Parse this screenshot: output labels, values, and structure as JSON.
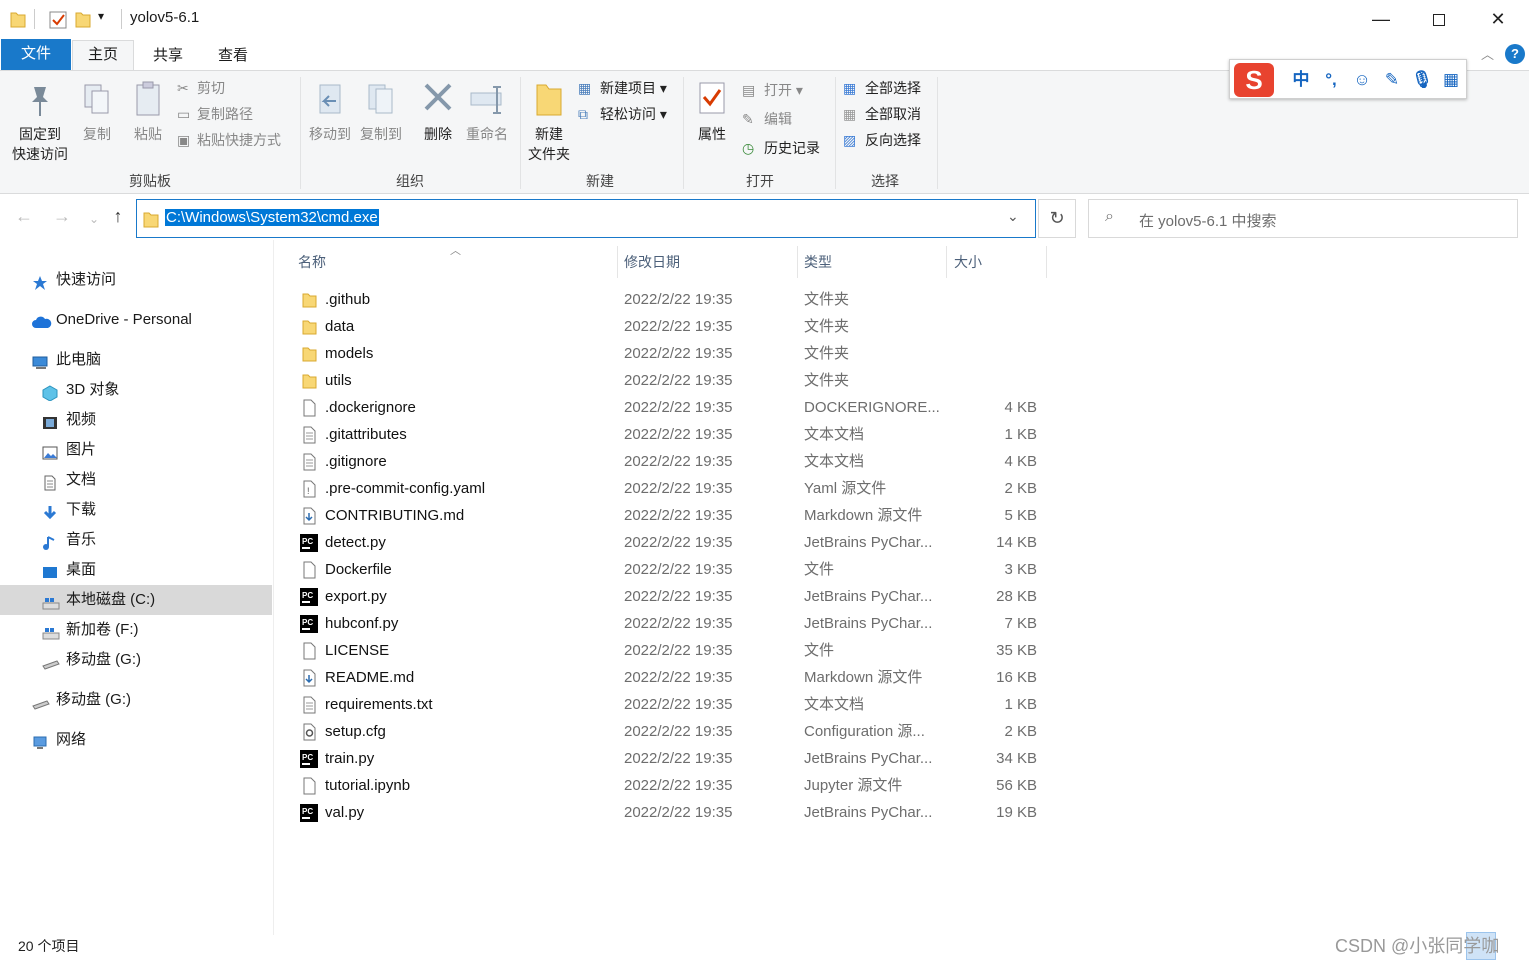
{
  "window": {
    "title": "yolov5-6.1",
    "qat_dropdown": "▾"
  },
  "ribbon_tabs": [
    "文件",
    "主页",
    "共享",
    "查看"
  ],
  "ribbon": {
    "clipboard": {
      "label": "剪贴板",
      "pin": "固定到\n快速访问",
      "copy": "复制",
      "paste": "粘贴",
      "cut": "剪切",
      "copy_path": "复制路径",
      "paste_shortcut": "粘贴快捷方式"
    },
    "organize": {
      "label": "组织",
      "move_to": "移动到",
      "copy_to": "复制到",
      "delete": "删除",
      "rename": "重命名"
    },
    "new": {
      "label": "新建",
      "new_folder": "新建\n文件夹",
      "new_item": "新建项目",
      "easy_access": "轻松访问"
    },
    "open": {
      "label": "打开",
      "properties": "属性",
      "open": "打开",
      "edit": "编辑",
      "history": "历史记录"
    },
    "select": {
      "label": "选择",
      "select_all": "全部选择",
      "select_none": "全部取消",
      "invert": "反向选择"
    }
  },
  "address": {
    "value": "C:\\Windows\\System32\\cmd.exe"
  },
  "search": {
    "placeholder": "在 yolov5-6.1 中搜索"
  },
  "sidebar": [
    {
      "label": "快速访问",
      "icon": "star-icon",
      "level": 0
    },
    {
      "label": "OneDrive - Personal",
      "icon": "cloud-icon",
      "level": 0
    },
    {
      "label": "此电脑",
      "icon": "computer-icon",
      "level": 0
    },
    {
      "label": "3D 对象",
      "icon": "cube-icon",
      "level": 1
    },
    {
      "label": "视频",
      "icon": "video-icon",
      "level": 1
    },
    {
      "label": "图片",
      "icon": "picture-icon",
      "level": 1
    },
    {
      "label": "文档",
      "icon": "document-icon",
      "level": 1
    },
    {
      "label": "下载",
      "icon": "download-icon",
      "level": 1
    },
    {
      "label": "音乐",
      "icon": "music-icon",
      "level": 1
    },
    {
      "label": "桌面",
      "icon": "desktop-icon",
      "level": 1
    },
    {
      "label": "本地磁盘 (C:)",
      "icon": "drive-icon",
      "level": 1,
      "selected": true
    },
    {
      "label": "新加卷 (F:)",
      "icon": "drive-icon",
      "level": 1
    },
    {
      "label": "移动盘 (G:)",
      "icon": "usb-drive-icon",
      "level": 1
    },
    {
      "label": "移动盘 (G:)",
      "icon": "usb-drive-icon",
      "level": 0
    },
    {
      "label": "网络",
      "icon": "network-icon",
      "level": 0
    }
  ],
  "columns": {
    "name": "名称",
    "date": "修改日期",
    "type": "类型",
    "size": "大小"
  },
  "files": [
    {
      "name": ".github",
      "date": "2022/2/22 19:35",
      "type": "文件夹",
      "size": "",
      "icon": "folder-icon"
    },
    {
      "name": "data",
      "date": "2022/2/22 19:35",
      "type": "文件夹",
      "size": "",
      "icon": "folder-icon"
    },
    {
      "name": "models",
      "date": "2022/2/22 19:35",
      "type": "文件夹",
      "size": "",
      "icon": "folder-icon"
    },
    {
      "name": "utils",
      "date": "2022/2/22 19:35",
      "type": "文件夹",
      "size": "",
      "icon": "folder-icon"
    },
    {
      "name": ".dockerignore",
      "date": "2022/2/22 19:35",
      "type": "DOCKERIGNORE...",
      "size": "4 KB",
      "icon": "blank-file-icon"
    },
    {
      "name": ".gitattributes",
      "date": "2022/2/22 19:35",
      "type": "文本文档",
      "size": "1 KB",
      "icon": "text-file-icon"
    },
    {
      "name": ".gitignore",
      "date": "2022/2/22 19:35",
      "type": "文本文档",
      "size": "4 KB",
      "icon": "text-file-icon"
    },
    {
      "name": ".pre-commit-config.yaml",
      "date": "2022/2/22 19:35",
      "type": "Yaml 源文件",
      "size": "2 KB",
      "icon": "yaml-file-icon"
    },
    {
      "name": "CONTRIBUTING.md",
      "date": "2022/2/22 19:35",
      "type": "Markdown 源文件",
      "size": "5 KB",
      "icon": "markdown-file-icon"
    },
    {
      "name": "detect.py",
      "date": "2022/2/22 19:35",
      "type": "JetBrains PyChar...",
      "size": "14 KB",
      "icon": "pycharm-file-icon"
    },
    {
      "name": "Dockerfile",
      "date": "2022/2/22 19:35",
      "type": "文件",
      "size": "3 KB",
      "icon": "blank-file-icon"
    },
    {
      "name": "export.py",
      "date": "2022/2/22 19:35",
      "type": "JetBrains PyChar...",
      "size": "28 KB",
      "icon": "pycharm-file-icon"
    },
    {
      "name": "hubconf.py",
      "date": "2022/2/22 19:35",
      "type": "JetBrains PyChar...",
      "size": "7 KB",
      "icon": "pycharm-file-icon"
    },
    {
      "name": "LICENSE",
      "date": "2022/2/22 19:35",
      "type": "文件",
      "size": "35 KB",
      "icon": "blank-file-icon"
    },
    {
      "name": "README.md",
      "date": "2022/2/22 19:35",
      "type": "Markdown 源文件",
      "size": "16 KB",
      "icon": "markdown-file-icon"
    },
    {
      "name": "requirements.txt",
      "date": "2022/2/22 19:35",
      "type": "文本文档",
      "size": "1 KB",
      "icon": "text-file-icon"
    },
    {
      "name": "setup.cfg",
      "date": "2022/2/22 19:35",
      "type": "Configuration 源...",
      "size": "2 KB",
      "icon": "config-file-icon"
    },
    {
      "name": "train.py",
      "date": "2022/2/22 19:35",
      "type": "JetBrains PyChar...",
      "size": "34 KB",
      "icon": "pycharm-file-icon"
    },
    {
      "name": "tutorial.ipynb",
      "date": "2022/2/22 19:35",
      "type": "Jupyter 源文件",
      "size": "56 KB",
      "icon": "notebook-file-icon"
    },
    {
      "name": "val.py",
      "date": "2022/2/22 19:35",
      "type": "JetBrains PyChar...",
      "size": "19 KB",
      "icon": "pycharm-file-icon"
    }
  ],
  "status": {
    "count": "20 个项目"
  },
  "watermark": "CSDN @小张同学咖",
  "ime": {
    "lang": "中",
    "punct": "°,"
  },
  "colors": {
    "accent": "#1979ca",
    "folder": "#f8d775",
    "selection": "#0078d7"
  }
}
